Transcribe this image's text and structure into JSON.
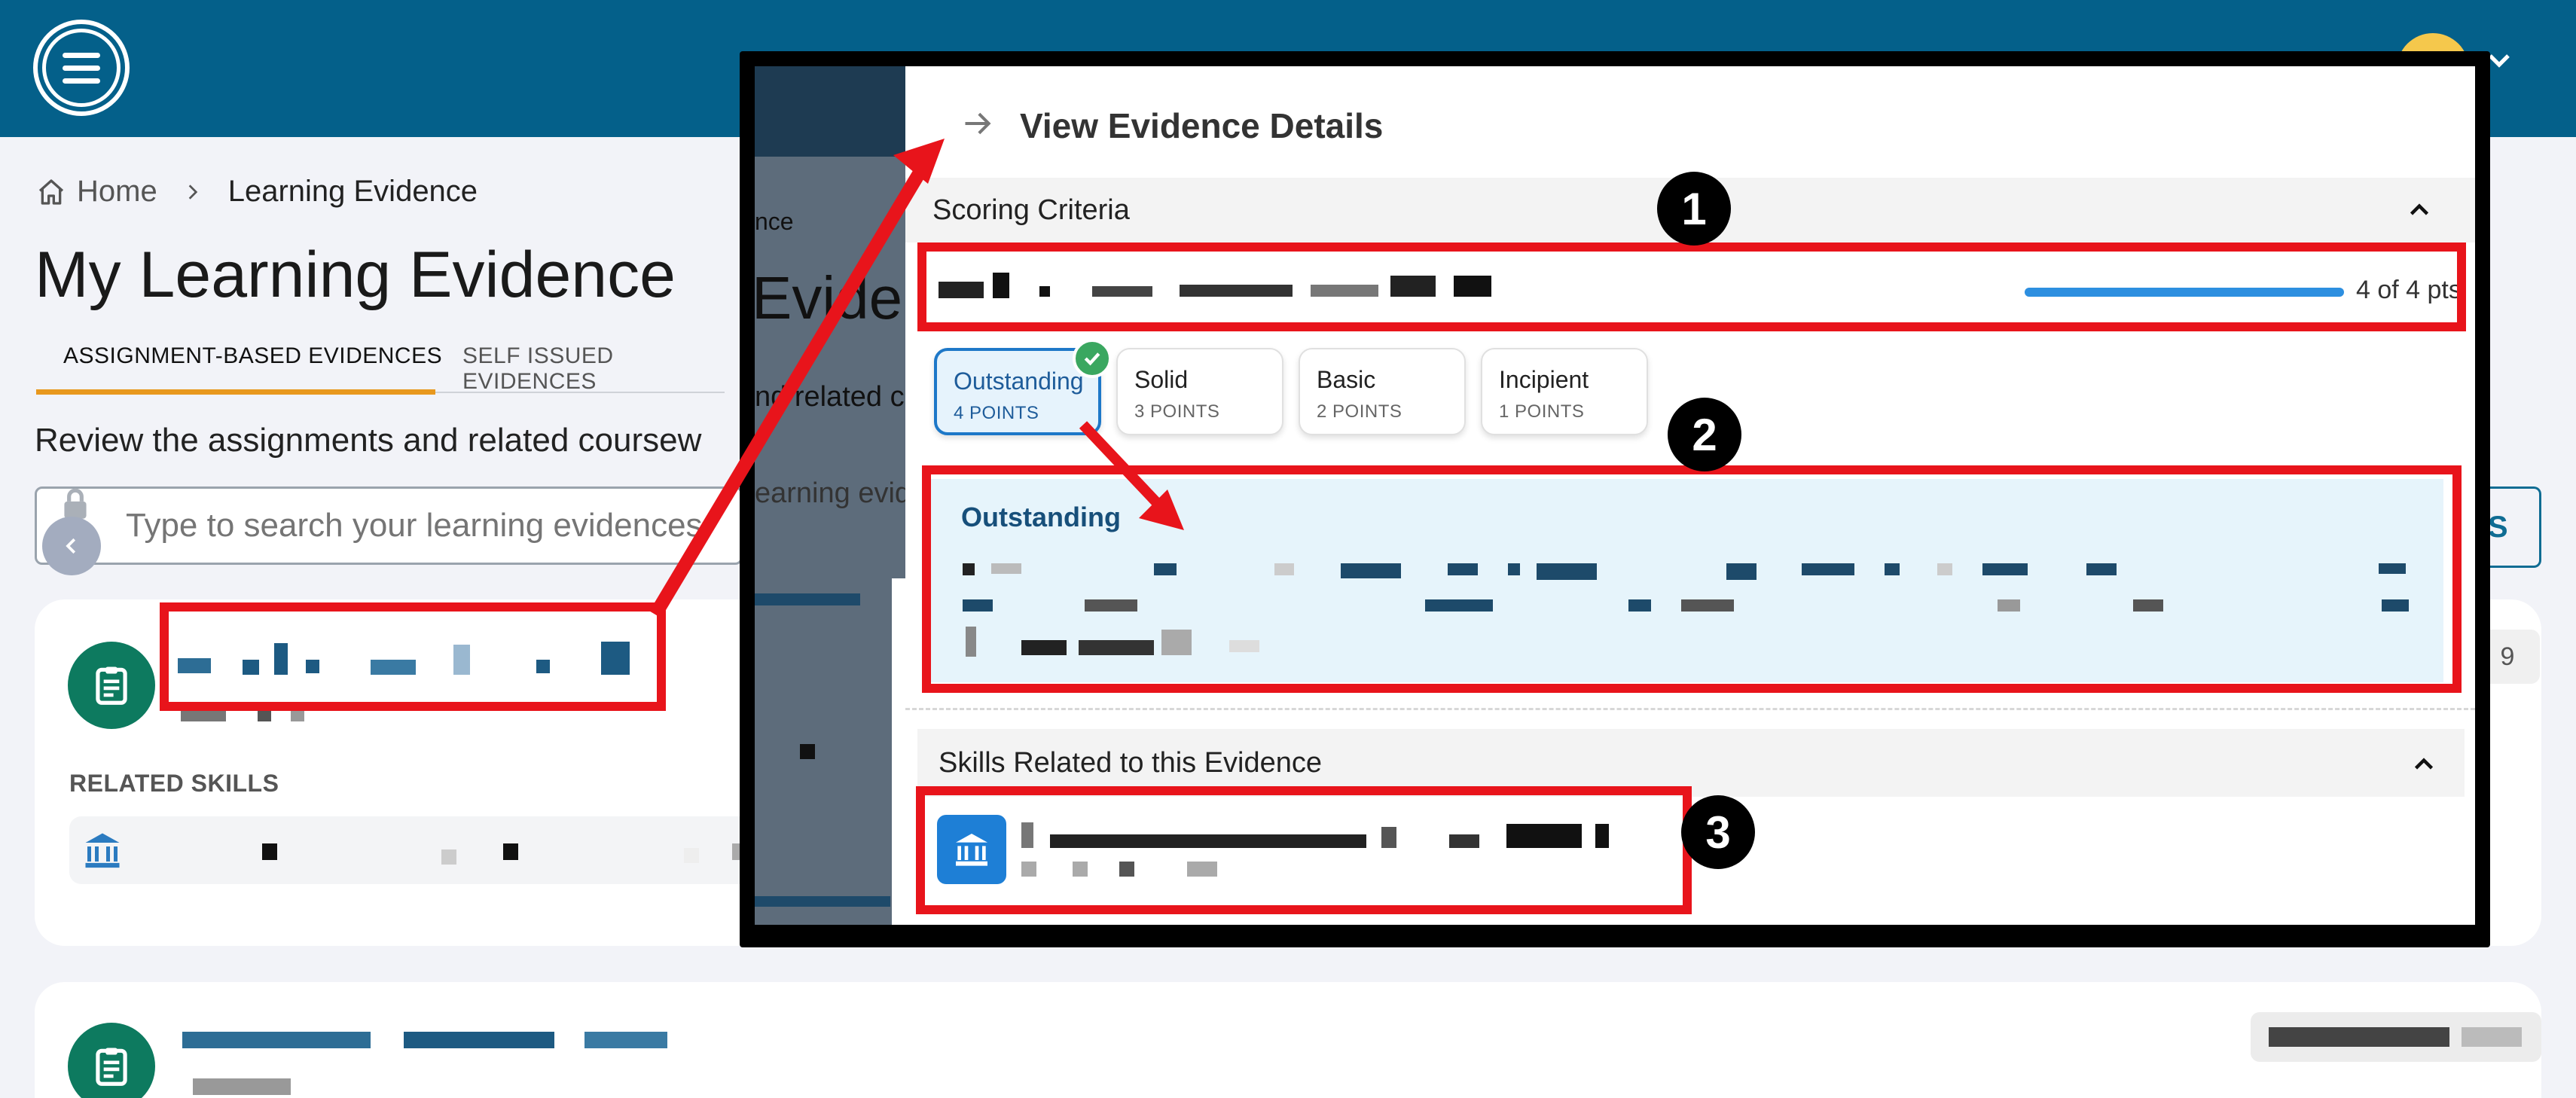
{
  "header": {
    "menu_icon": "hamburger-menu-icon",
    "avatar_color": "#f5c84c",
    "bar_color": "#04608a"
  },
  "breadcrumb": {
    "home": "Home",
    "current": "Learning Evidence"
  },
  "page": {
    "title": "My Learning Evidence",
    "subtitle": "Review the assignments and related coursew",
    "tabs": [
      {
        "label": "ASSIGNMENT-BASED EVIDENCES",
        "active": true
      },
      {
        "label": "SELF ISSUED EVIDENCES",
        "active": false
      }
    ],
    "search_placeholder": "Type to search your learning evidences",
    "filter_label": "RS",
    "accent_color": "#e8981e"
  },
  "cards": [
    {
      "related_skills_label": "RELATED SKILLS",
      "date_badge": "9"
    },
    {
      "date_badge": ""
    }
  ],
  "modal": {
    "background_fragments": {
      "crumb": "nce",
      "title": "Evidenc",
      "subtitle": "nd related c",
      "search": "earning evid"
    },
    "title": "View Evidence Details",
    "scoring_section": "Scoring Criteria",
    "criterion": {
      "score_text": "4 of 4 pts",
      "progress": 1.0
    },
    "levels": [
      {
        "name": "Outstanding",
        "points": "4 POINTS",
        "selected": true
      },
      {
        "name": "Solid",
        "points": "3 POINTS",
        "selected": false
      },
      {
        "name": "Basic",
        "points": "2 POINTS",
        "selected": false
      },
      {
        "name": "Incipient",
        "points": "1 POINTS",
        "selected": false
      }
    ],
    "selected_level_title": "Outstanding",
    "skills_section": "Skills Related to this Evidence"
  },
  "annotations": {
    "markers": [
      "1",
      "2",
      "3"
    ],
    "highlight_color": "#e8141b"
  }
}
